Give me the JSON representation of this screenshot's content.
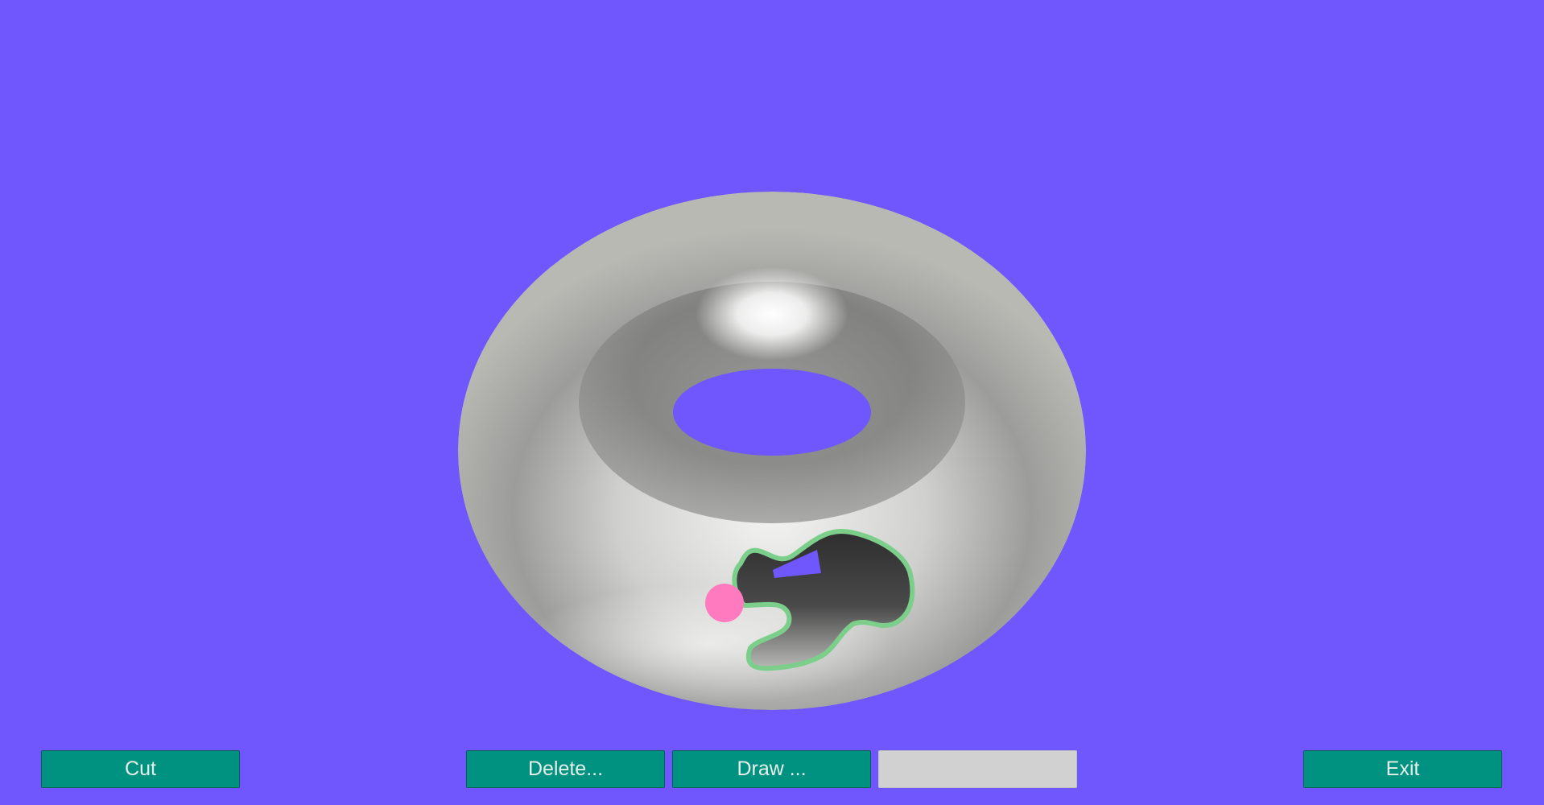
{
  "scene": {
    "background_color": "#6f56fd",
    "object": "torus",
    "torus_color": "#d8d8d8",
    "hole_outline_color": "#7ccf8a",
    "hole_fill_color": "#333333",
    "marker_color": "#ff7abf"
  },
  "toolbar": {
    "cut_label": "Cut",
    "delete_label": "Delete...",
    "draw_label": "Draw ...",
    "blank_label": "",
    "exit_label": "Exit",
    "button_color": "#009281",
    "disabled_color": "#d1d1d1"
  }
}
